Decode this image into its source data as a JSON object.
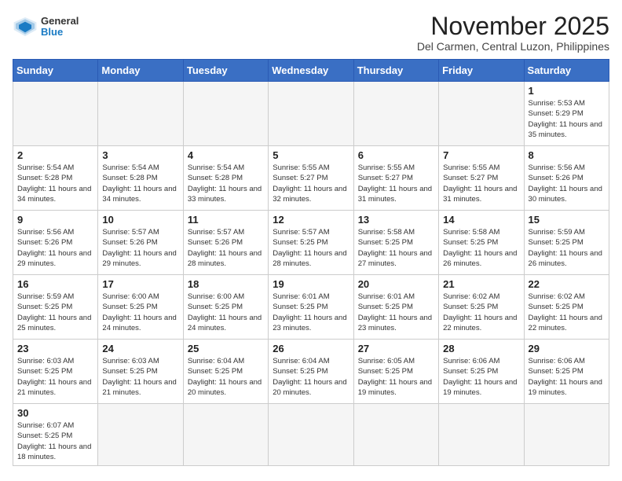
{
  "header": {
    "logo_general": "General",
    "logo_blue": "Blue",
    "month_title": "November 2025",
    "location": "Del Carmen, Central Luzon, Philippines"
  },
  "days_of_week": [
    "Sunday",
    "Monday",
    "Tuesday",
    "Wednesday",
    "Thursday",
    "Friday",
    "Saturday"
  ],
  "weeks": [
    [
      {
        "day": "",
        "info": ""
      },
      {
        "day": "",
        "info": ""
      },
      {
        "day": "",
        "info": ""
      },
      {
        "day": "",
        "info": ""
      },
      {
        "day": "",
        "info": ""
      },
      {
        "day": "",
        "info": ""
      },
      {
        "day": "1",
        "info": "Sunrise: 5:53 AM\nSunset: 5:29 PM\nDaylight: 11 hours\nand 35 minutes."
      }
    ],
    [
      {
        "day": "2",
        "info": "Sunrise: 5:54 AM\nSunset: 5:28 PM\nDaylight: 11 hours\nand 34 minutes."
      },
      {
        "day": "3",
        "info": "Sunrise: 5:54 AM\nSunset: 5:28 PM\nDaylight: 11 hours\nand 34 minutes."
      },
      {
        "day": "4",
        "info": "Sunrise: 5:54 AM\nSunset: 5:28 PM\nDaylight: 11 hours\nand 33 minutes."
      },
      {
        "day": "5",
        "info": "Sunrise: 5:55 AM\nSunset: 5:27 PM\nDaylight: 11 hours\nand 32 minutes."
      },
      {
        "day": "6",
        "info": "Sunrise: 5:55 AM\nSunset: 5:27 PM\nDaylight: 11 hours\nand 31 minutes."
      },
      {
        "day": "7",
        "info": "Sunrise: 5:55 AM\nSunset: 5:27 PM\nDaylight: 11 hours\nand 31 minutes."
      },
      {
        "day": "8",
        "info": "Sunrise: 5:56 AM\nSunset: 5:26 PM\nDaylight: 11 hours\nand 30 minutes."
      }
    ],
    [
      {
        "day": "9",
        "info": "Sunrise: 5:56 AM\nSunset: 5:26 PM\nDaylight: 11 hours\nand 29 minutes."
      },
      {
        "day": "10",
        "info": "Sunrise: 5:57 AM\nSunset: 5:26 PM\nDaylight: 11 hours\nand 29 minutes."
      },
      {
        "day": "11",
        "info": "Sunrise: 5:57 AM\nSunset: 5:26 PM\nDaylight: 11 hours\nand 28 minutes."
      },
      {
        "day": "12",
        "info": "Sunrise: 5:57 AM\nSunset: 5:25 PM\nDaylight: 11 hours\nand 28 minutes."
      },
      {
        "day": "13",
        "info": "Sunrise: 5:58 AM\nSunset: 5:25 PM\nDaylight: 11 hours\nand 27 minutes."
      },
      {
        "day": "14",
        "info": "Sunrise: 5:58 AM\nSunset: 5:25 PM\nDaylight: 11 hours\nand 26 minutes."
      },
      {
        "day": "15",
        "info": "Sunrise: 5:59 AM\nSunset: 5:25 PM\nDaylight: 11 hours\nand 26 minutes."
      }
    ],
    [
      {
        "day": "16",
        "info": "Sunrise: 5:59 AM\nSunset: 5:25 PM\nDaylight: 11 hours\nand 25 minutes."
      },
      {
        "day": "17",
        "info": "Sunrise: 6:00 AM\nSunset: 5:25 PM\nDaylight: 11 hours\nand 24 minutes."
      },
      {
        "day": "18",
        "info": "Sunrise: 6:00 AM\nSunset: 5:25 PM\nDaylight: 11 hours\nand 24 minutes."
      },
      {
        "day": "19",
        "info": "Sunrise: 6:01 AM\nSunset: 5:25 PM\nDaylight: 11 hours\nand 23 minutes."
      },
      {
        "day": "20",
        "info": "Sunrise: 6:01 AM\nSunset: 5:25 PM\nDaylight: 11 hours\nand 23 minutes."
      },
      {
        "day": "21",
        "info": "Sunrise: 6:02 AM\nSunset: 5:25 PM\nDaylight: 11 hours\nand 22 minutes."
      },
      {
        "day": "22",
        "info": "Sunrise: 6:02 AM\nSunset: 5:25 PM\nDaylight: 11 hours\nand 22 minutes."
      }
    ],
    [
      {
        "day": "23",
        "info": "Sunrise: 6:03 AM\nSunset: 5:25 PM\nDaylight: 11 hours\nand 21 minutes."
      },
      {
        "day": "24",
        "info": "Sunrise: 6:03 AM\nSunset: 5:25 PM\nDaylight: 11 hours\nand 21 minutes."
      },
      {
        "day": "25",
        "info": "Sunrise: 6:04 AM\nSunset: 5:25 PM\nDaylight: 11 hours\nand 20 minutes."
      },
      {
        "day": "26",
        "info": "Sunrise: 6:04 AM\nSunset: 5:25 PM\nDaylight: 11 hours\nand 20 minutes."
      },
      {
        "day": "27",
        "info": "Sunrise: 6:05 AM\nSunset: 5:25 PM\nDaylight: 11 hours\nand 19 minutes."
      },
      {
        "day": "28",
        "info": "Sunrise: 6:06 AM\nSunset: 5:25 PM\nDaylight: 11 hours\nand 19 minutes."
      },
      {
        "day": "29",
        "info": "Sunrise: 6:06 AM\nSunset: 5:25 PM\nDaylight: 11 hours\nand 19 minutes."
      }
    ],
    [
      {
        "day": "30",
        "info": "Sunrise: 6:07 AM\nSunset: 5:25 PM\nDaylight: 11 hours\nand 18 minutes."
      },
      {
        "day": "",
        "info": ""
      },
      {
        "day": "",
        "info": ""
      },
      {
        "day": "",
        "info": ""
      },
      {
        "day": "",
        "info": ""
      },
      {
        "day": "",
        "info": ""
      },
      {
        "day": "",
        "info": ""
      }
    ]
  ]
}
